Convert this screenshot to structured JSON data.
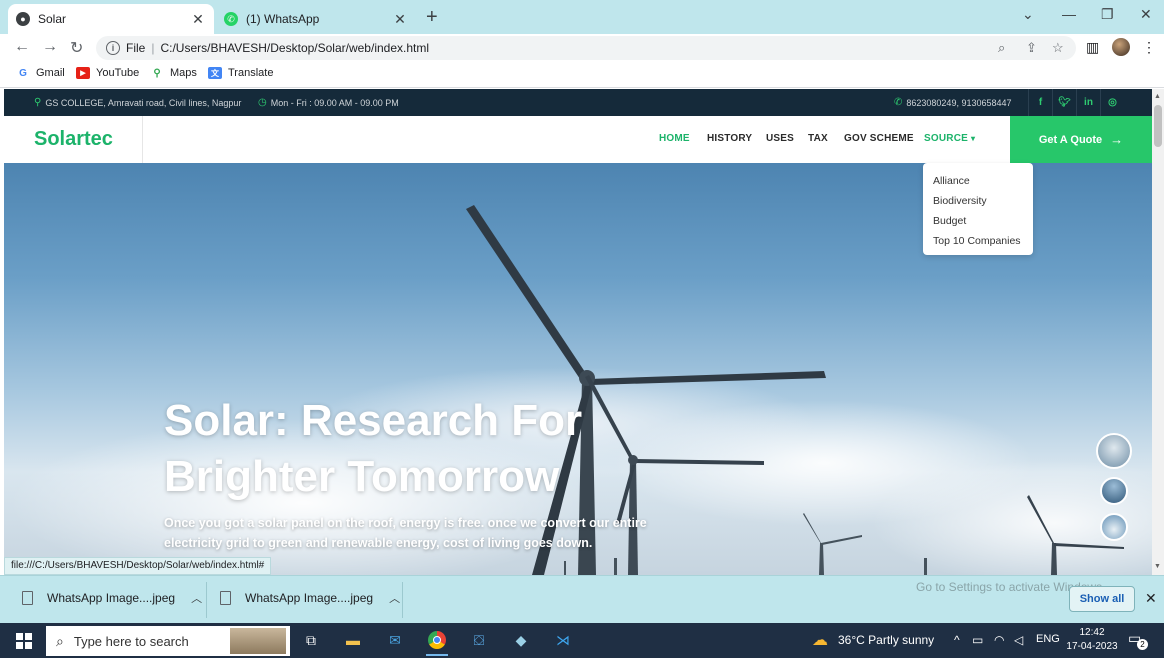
{
  "browser": {
    "tabs": [
      {
        "title": "Solar",
        "close": "✕"
      },
      {
        "title": "(1) WhatsApp",
        "close": "✕"
      }
    ],
    "new_tab": "+",
    "omnibox": {
      "scheme": "File",
      "url": "C:/Users/BHAVESH/Desktop/Solar/web/index.html"
    },
    "bookmarks": [
      "Gmail",
      "YouTube",
      "Maps",
      "Translate"
    ],
    "status_url": "file:///C:/Users/BHAVESH/Desktop/Solar/web/index.html#"
  },
  "site": {
    "topbar": {
      "address": "GS COLLEGE, Amravati road, Civil lines, Nagpur",
      "hours": "Mon - Fri : 09.00 AM - 09.00 PM",
      "phone": "8623080249, 9130658447",
      "social": [
        "f",
        "t",
        "in",
        "ig"
      ]
    },
    "brand": "Solartec",
    "menu": [
      "HOME",
      "HISTORY",
      "USES",
      "TAX",
      "GOV SCHEME",
      "SOURCE"
    ],
    "quote_button": "Get A Quote",
    "dropdown": [
      "Alliance",
      "Biodiversity",
      "Budget",
      "Top 10 Companies"
    ],
    "hero": {
      "title_line1": "Solar: Research For",
      "title_line2": "Brighter Tomorrow",
      "subtitle": "Once you got a solar panel on the roof, energy is free. once we convert our entire electricity grid to green and renewable energy, cost of living goes down."
    }
  },
  "downloads": {
    "items": [
      "WhatsApp Image....jpeg",
      "WhatsApp Image....jpeg"
    ],
    "activate_text": "Go to Settings to activate Windows.",
    "show_all": "Show all"
  },
  "taskbar": {
    "search_placeholder": "Type here to search",
    "weather": "36°C  Partly sunny",
    "language": "ENG",
    "time": "12:42",
    "date": "17-04-2023",
    "notifications": "2"
  },
  "colors": {
    "accent": "#27c76a",
    "topbar_bg": "#152a3a",
    "chrome_bg": "#bfe6ec",
    "taskbar_bg": "#1f2f44"
  }
}
